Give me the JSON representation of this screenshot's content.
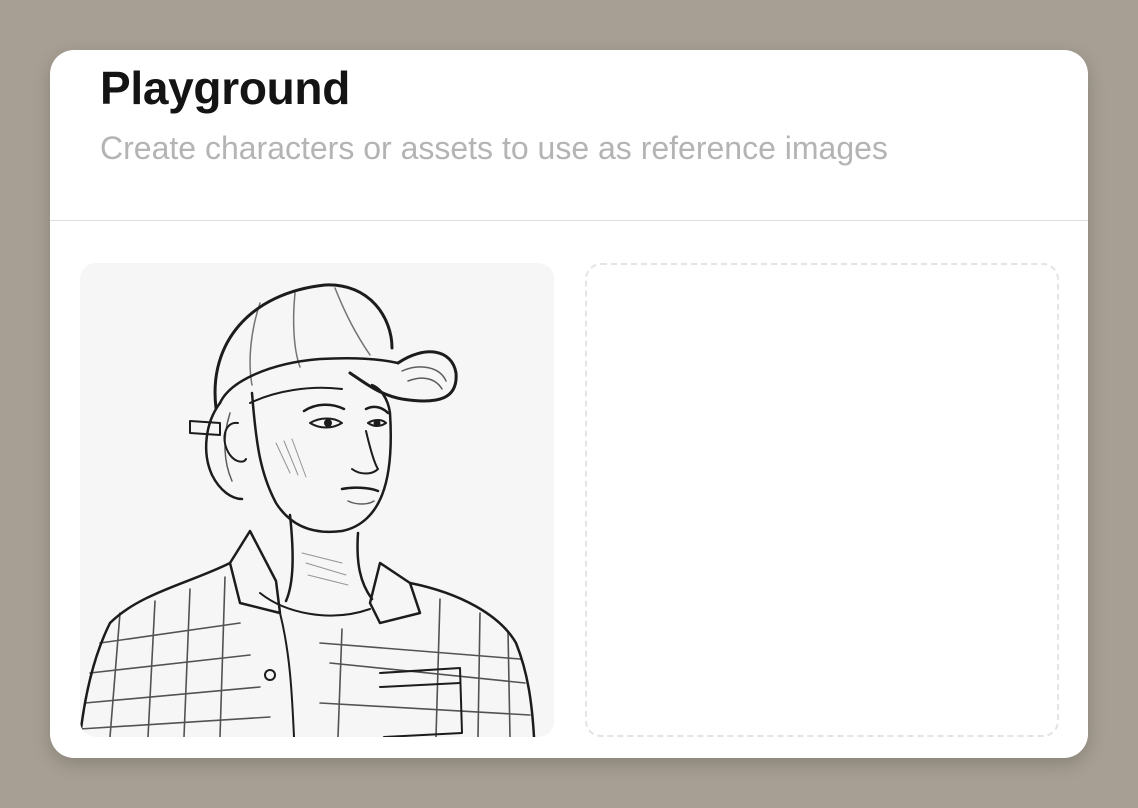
{
  "page": {
    "title": "Playground",
    "subtitle": "Create characters or assets to use as reference images"
  },
  "gallery": {
    "items": [
      {
        "kind": "image",
        "icon": "sketch-portrait-image"
      },
      {
        "kind": "empty-slot",
        "icon": ""
      }
    ]
  },
  "colors": {
    "background": "#a79f93",
    "card": "#ffffff",
    "title": "#141414",
    "subtitle": "#b4b4b4",
    "divider": "#dedede",
    "dashed_border": "#e4e4e4"
  }
}
